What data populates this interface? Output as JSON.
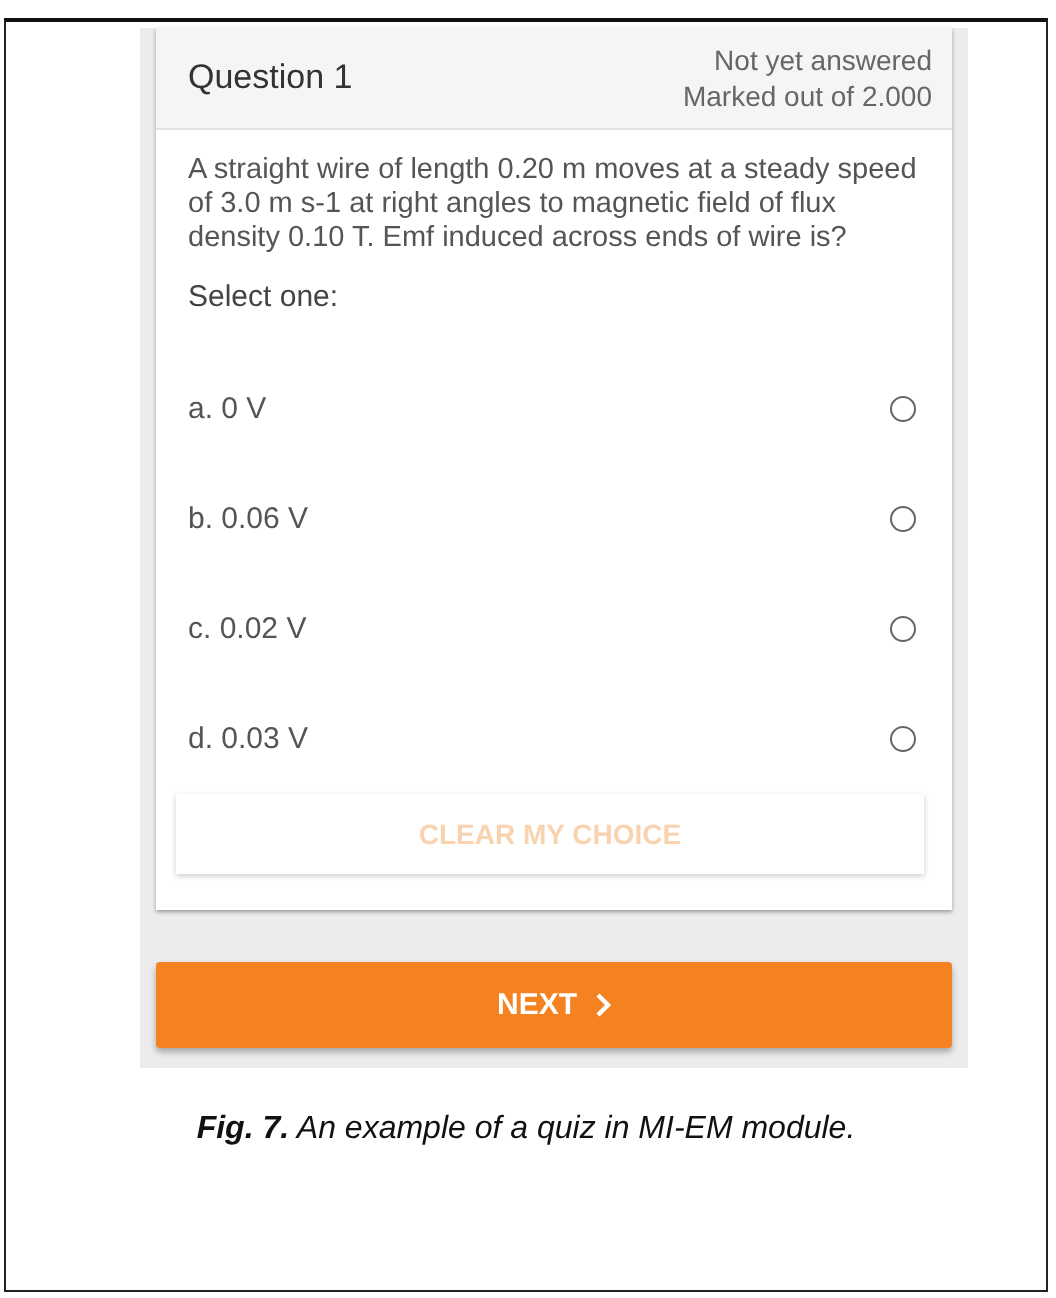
{
  "question": {
    "title": "Question 1",
    "status": "Not yet answered",
    "marks": "Marked out of 2.000",
    "text": "A straight wire of length 0.20 m moves at a steady speed of 3.0 m s-1 at right angles to magnetic field of flux density 0.10 T. Emf induced across ends of wire is?",
    "prompt": "Select one:",
    "options": [
      {
        "label": "a. 0 V",
        "selected": false
      },
      {
        "label": "b. 0.06 V",
        "selected": false
      },
      {
        "label": "c. 0.02 V",
        "selected": false
      },
      {
        "label": "d. 0.03 V",
        "selected": false
      }
    ],
    "clear_button": {
      "label": "CLEAR MY CHOICE",
      "disabled": true
    }
  },
  "next_button": {
    "label": "NEXT"
  },
  "caption": "**Fig. 7.** An example of a quiz in MI-EM module."
}
